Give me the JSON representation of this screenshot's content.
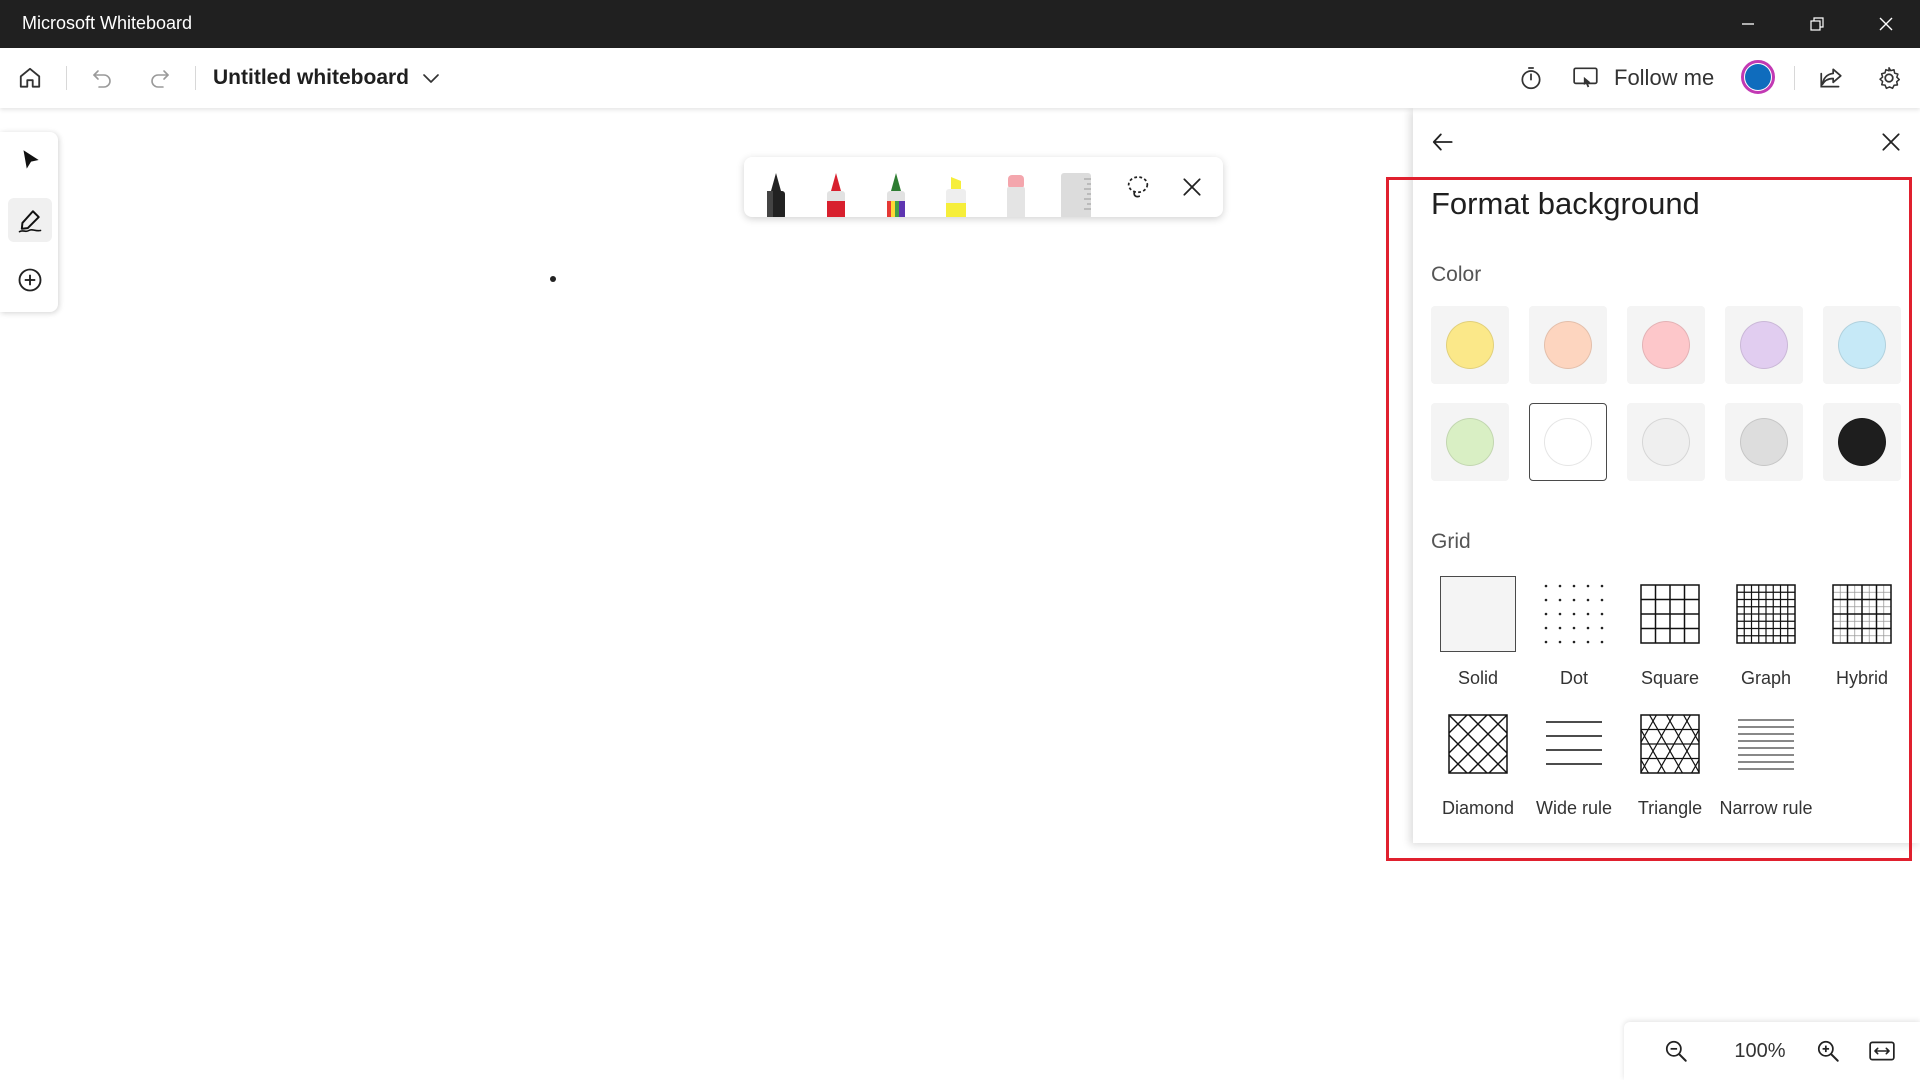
{
  "window": {
    "title": "Microsoft Whiteboard"
  },
  "toolbar": {
    "board_name": "Untitled whiteboard",
    "follow_me_label": "Follow me"
  },
  "panel": {
    "title": "Format background",
    "color_label": "Color",
    "grid_label": "Grid",
    "colors": [
      "#fbe889",
      "#fdd5bf",
      "#fdc7ca",
      "#e1cdf0",
      "#c6e9f7",
      "#d9efc4",
      "#ffffff",
      "#efefef",
      "#dddddd",
      "#1e1e1e"
    ],
    "selected_color": "#ffffff",
    "grids": [
      {
        "label": "Solid"
      },
      {
        "label": "Dot"
      },
      {
        "label": "Square"
      },
      {
        "label": "Graph"
      },
      {
        "label": "Hybrid"
      },
      {
        "label": "Diamond"
      },
      {
        "label": "Wide rule"
      },
      {
        "label": "Triangle"
      },
      {
        "label": "Narrow rule"
      }
    ],
    "selected_grid": "Solid"
  },
  "zoom": {
    "value": "100%"
  },
  "ink": {
    "pens": [
      "black-pen",
      "red-pen",
      "rainbow-pen",
      "yellow-highlighter",
      "eraser",
      "ruler"
    ]
  },
  "colors": {
    "title_bar": "#202020",
    "highlight_frame": "#e0202e",
    "avatar_ring": "#c239b3",
    "avatar_fill": "#0f6cbd"
  }
}
